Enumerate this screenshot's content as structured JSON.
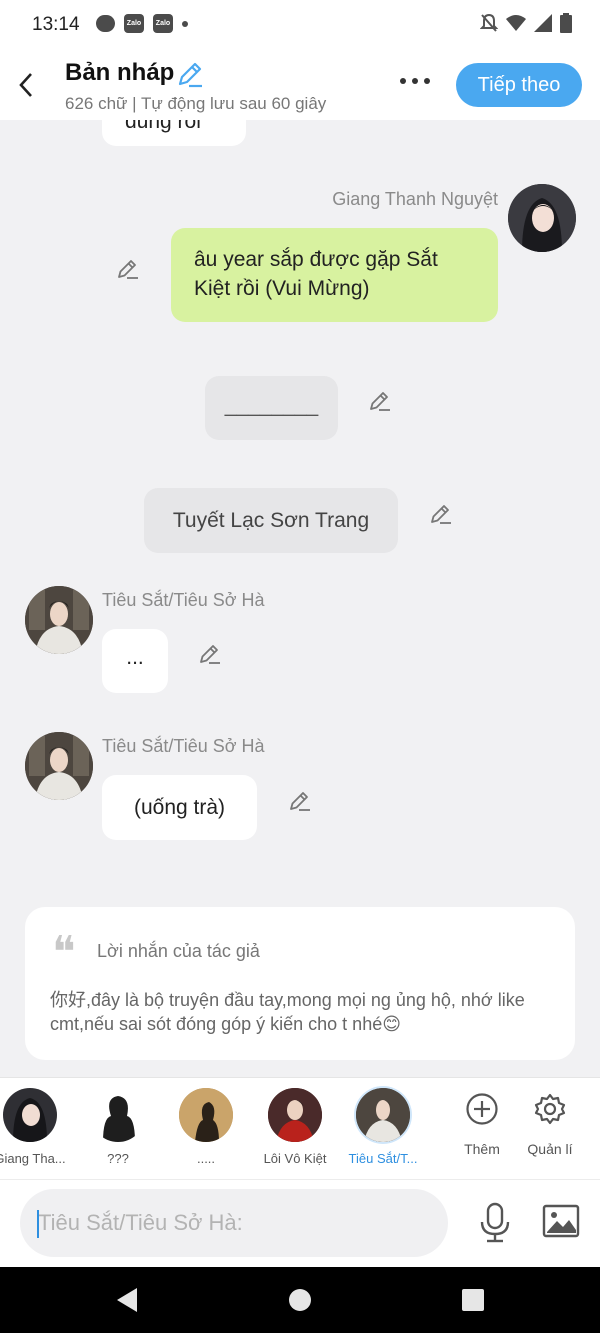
{
  "status_bar": {
    "time": "13:14",
    "zalo_label": "Zalo"
  },
  "header": {
    "title": "Bản nháp",
    "subtitle": "626 chữ | Tự động lưu sau 60 giây",
    "next_label": "Tiếp theo"
  },
  "messages": {
    "m0": {
      "text": "đúng rồi"
    },
    "m1": {
      "author": "Giang Thanh Nguyệt",
      "text": "âu year sắp được gặp Sắt Kiệt rồi (Vui Mừng)"
    },
    "m2": {
      "text": "________"
    },
    "m3": {
      "text": "Tuyết Lạc Sơn Trang"
    },
    "m4": {
      "author": "Tiêu Sắt/Tiêu Sở Hà",
      "text": "..."
    },
    "m5": {
      "author": "Tiêu Sắt/Tiêu Sở Hà",
      "text": "(uống trà)"
    }
  },
  "author_note": {
    "title": "Lời nhắn của tác giả",
    "body": "你好,đây là bộ truyện đầu tay,mong mọi ng ủng hộ, nhớ like cmt,nếu sai sót đóng góp ý kiến cho t nhé😊"
  },
  "characters": [
    {
      "label": "Giang Tha..."
    },
    {
      "label": "???"
    },
    {
      "label": "....."
    },
    {
      "label": "Lôi Vô Kiệt"
    },
    {
      "label": "Tiêu Sắt/T..."
    }
  ],
  "tools": {
    "add_label": "Thêm",
    "manage_label": "Quản lí"
  },
  "input": {
    "placeholder": "Tiêu Sắt/Tiêu Sở Hà:"
  },
  "colors": {
    "accent": "#4aa8f0",
    "green_bubble": "#d8f2a0",
    "background": "#f1f1f3"
  }
}
